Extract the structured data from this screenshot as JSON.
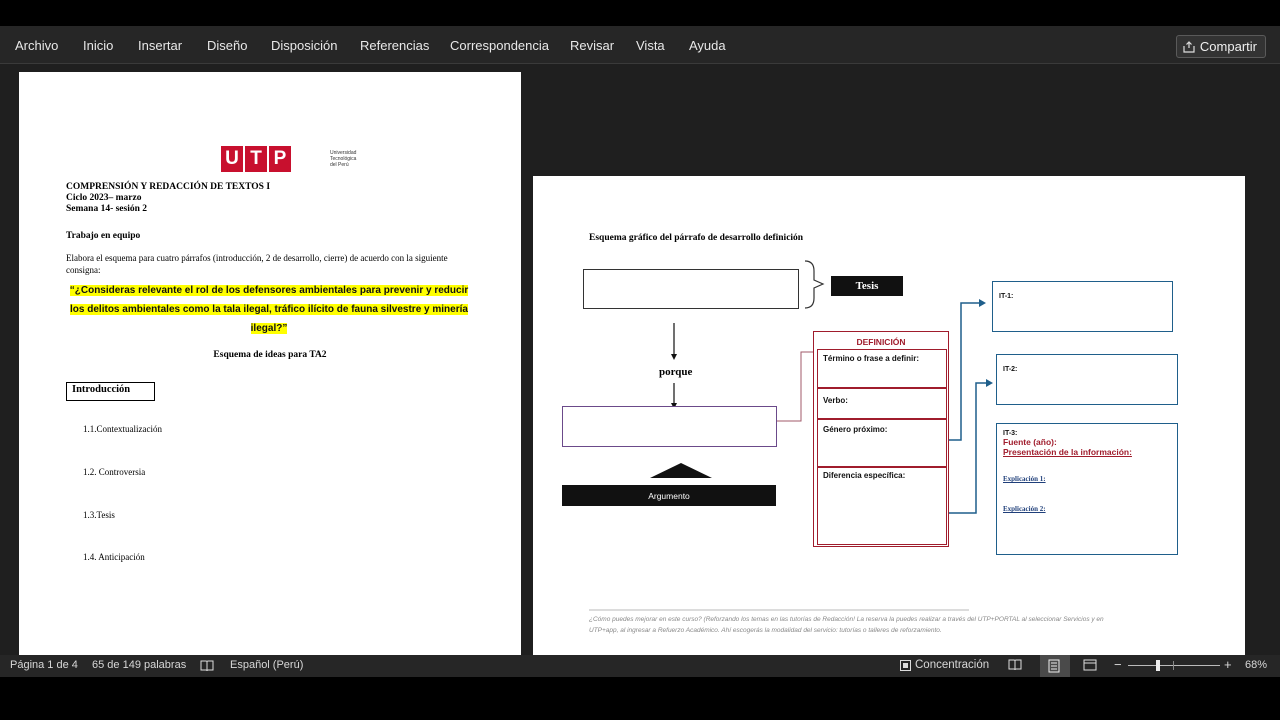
{
  "menu": {
    "items": [
      "Archivo",
      "Inicio",
      "Insertar",
      "Diseño",
      "Disposición",
      "Referencias",
      "Correspondencia",
      "Revisar",
      "Vista",
      "Ayuda"
    ],
    "share_label": "Compartir"
  },
  "page1": {
    "logo_letters": [
      "U",
      "T",
      "P"
    ],
    "logo_text": [
      "Universidad",
      "Tecnológica",
      "del Perú"
    ],
    "course": "COMPRENSIÓN Y REDACCIÓN DE TEXTOS I",
    "cycle": "Ciclo 2023– marzo",
    "week": "Semana 14- sesión 2",
    "work_label": "Trabajo en equipo",
    "instruction_1": "Elabora el esquema para cuatro párrafos (introducción, 2 de desarrollo, cierre) de acuerdo con la siguiente",
    "instruction_2": "consigna:",
    "question_1": "“¿Consideras relevante el rol de los defensores ambientales para prevenir y reducir",
    "question_2": "los delitos ambientales como la tala ilegal, tráfico ilícito de fauna silvestre y minería",
    "question_3": "ilegal?”",
    "scheme_title": "Esquema de ideas para TA2",
    "intro_label": "Introducción",
    "items": [
      "1.1.Contextualización",
      "1.2. Controversia",
      "1.3.Tesis",
      "1.4. Anticipación"
    ]
  },
  "page2": {
    "title": "Esquema gráfico del párrafo de desarrollo definición",
    "tesis": "Tesis",
    "porque": "porque",
    "argumento": "Argumento",
    "definicion": "DEFINICIÓN",
    "def_rows": [
      "Término o frase a definir:",
      "Verbo:",
      "Género próximo:",
      "Diferencia específica:"
    ],
    "it1": "IT-1:",
    "it2": "IT-2:",
    "it3": "IT-3:",
    "fuente": "Fuente (año):",
    "presentacion": "Presentación de la información:",
    "explicacion1": "Explicación 1:",
    "explicacion2": "Explicación 2:",
    "footnote_1": "¿Cómo puedes mejorar en este curso? (Reforzando los temas en las tutorías de Redacción! La reserva la puedes realizar a través del UTP+PORTAL al seleccionar Servicios y en",
    "footnote_2": "UTP+app, al ingresar a Refuerzo Académico. Ahí escogerás la modalidad del servicio: tutorías o talleres de reforzamiento."
  },
  "status": {
    "page": "Página 1 de 4",
    "words": "65 de 149 palabras",
    "language": "Español (Perú)",
    "focus": "Concentración",
    "zoom": "68%",
    "zoom_level": 0.68
  },
  "colors": {
    "accent_red": "#a01c2c",
    "diagram_blue": "#1f5f8b",
    "highlight": "#ffff00"
  }
}
